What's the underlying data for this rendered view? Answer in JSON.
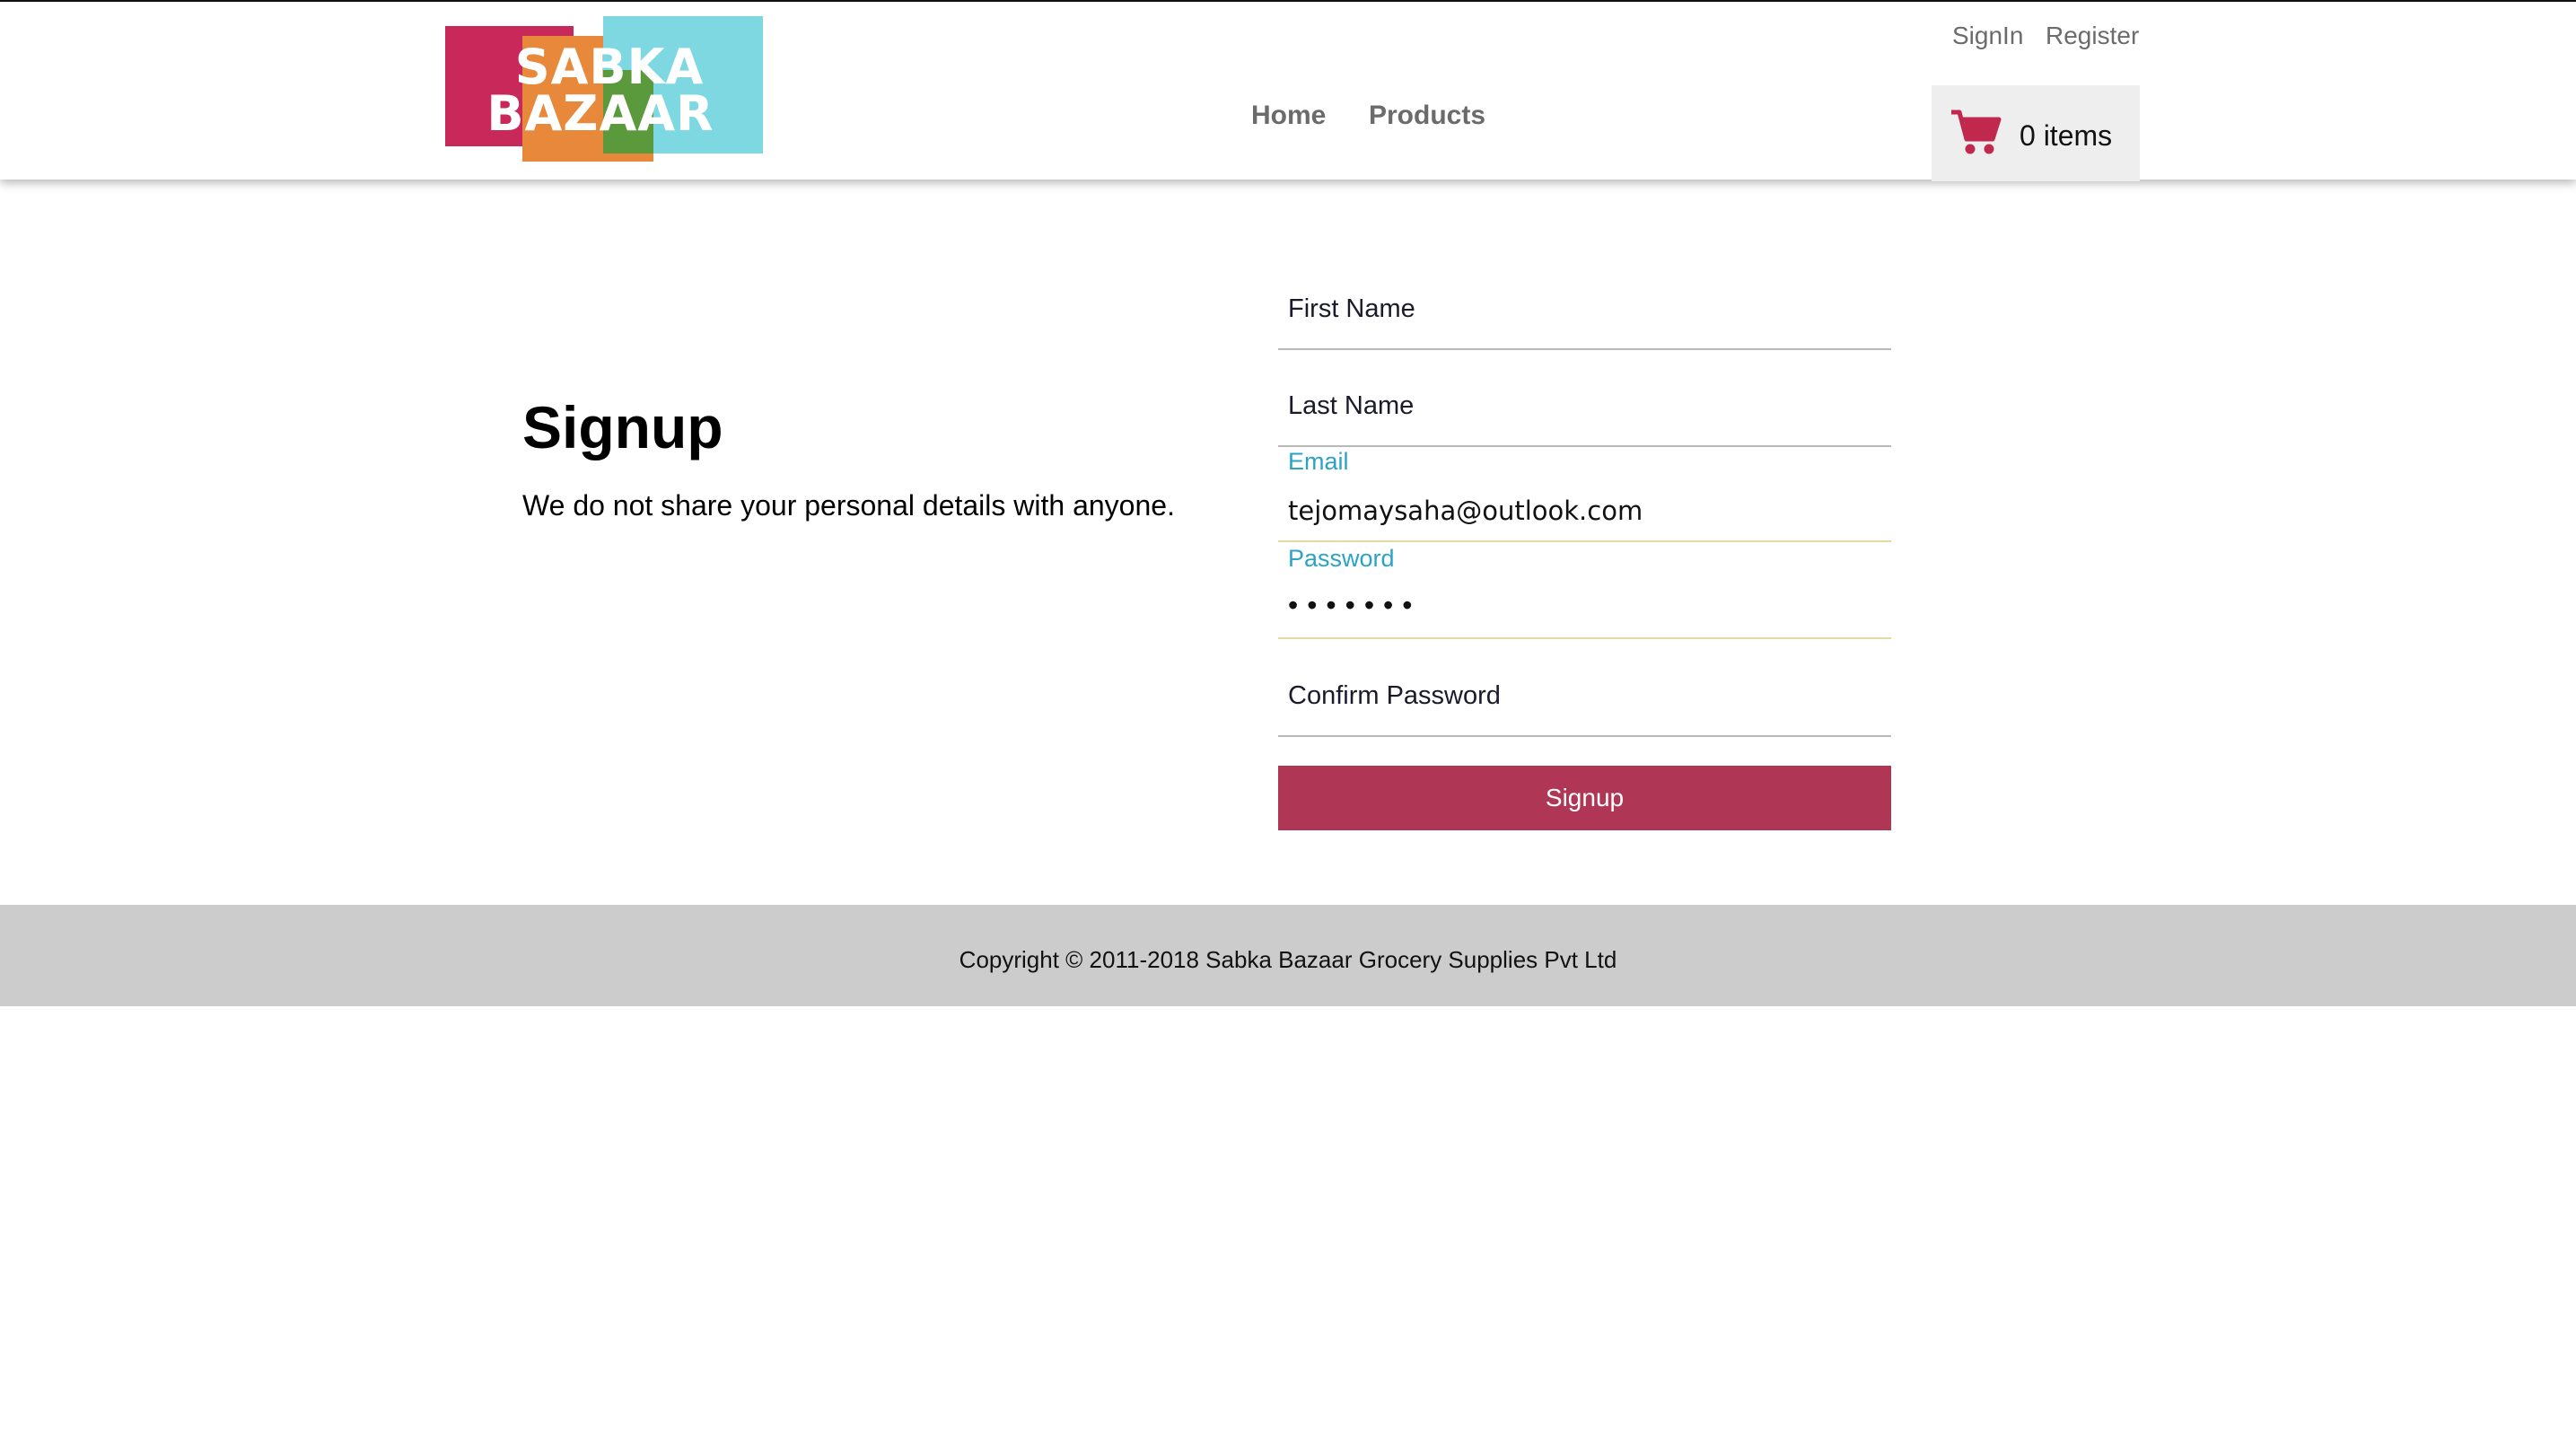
{
  "header": {
    "logo": {
      "line1": "SABKA",
      "line2": "BAZAAR"
    },
    "nav": {
      "home": "Home",
      "products": "Products"
    },
    "auth": {
      "signin": "SignIn",
      "register": "Register"
    },
    "cart": {
      "icon": "cart-icon",
      "count_label": "0 items",
      "accent": "#c0294d"
    }
  },
  "intro": {
    "title": "Signup",
    "subtitle": "We do not share your personal details with anyone."
  },
  "form": {
    "first_name": {
      "placeholder": "First Name",
      "value": ""
    },
    "last_name": {
      "placeholder": "Last Name",
      "value": ""
    },
    "email": {
      "label": "Email",
      "value": "tejomaysaha@outlook.com"
    },
    "password": {
      "label": "Password",
      "value": "•••••••"
    },
    "confirm_password": {
      "placeholder": "Confirm Password",
      "value": ""
    },
    "submit_label": "Signup"
  },
  "footer": {
    "copyright": "Copyright © 2011-2018 Sabka Bazaar Grocery Supplies Pvt Ltd"
  },
  "colors": {
    "primary_button": "#b03656",
    "label_accent": "#2aa3c4",
    "footer_bg": "#cccccc"
  }
}
